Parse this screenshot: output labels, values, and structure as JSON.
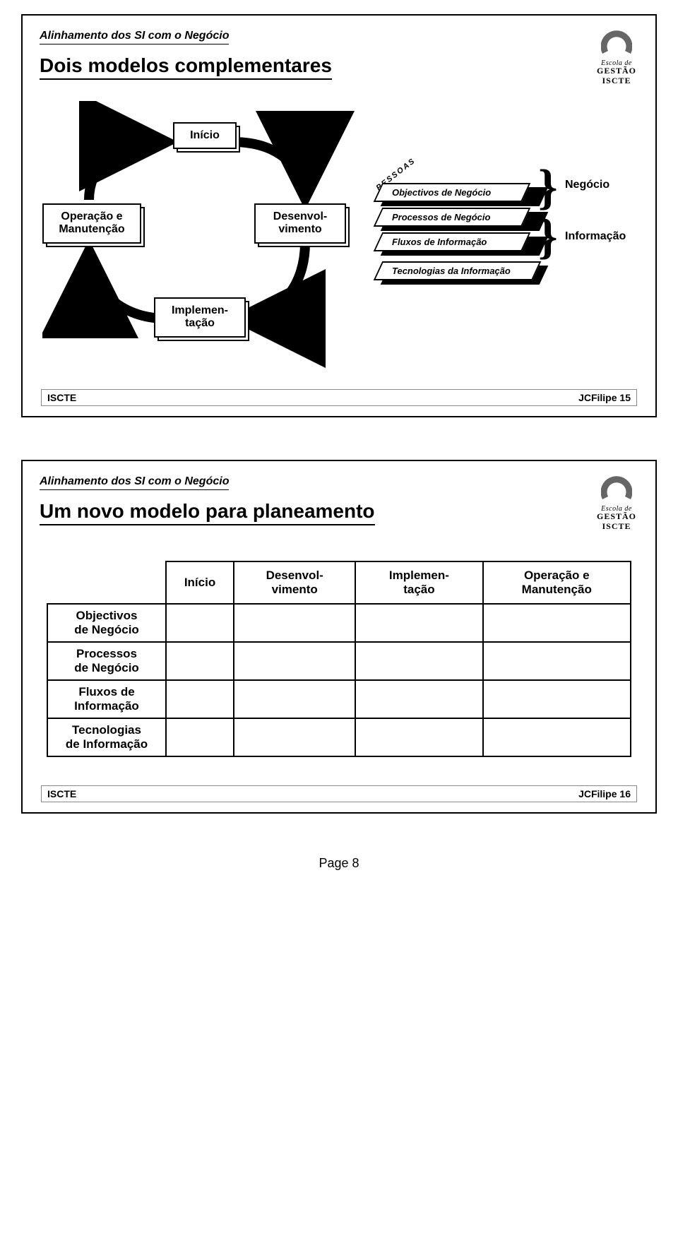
{
  "common": {
    "header": "Alinhamento dos SI com o Negócio",
    "footer_left": "ISCTE",
    "footer_right": "JCFilipe",
    "logo": {
      "l1": "Escola de",
      "l2": "GESTÃO",
      "l3": "ISCTE"
    }
  },
  "slide1": {
    "title": "Dois modelos complementares",
    "boxes": {
      "inicio": "Início",
      "operacao": "Operação e\nManutenção",
      "desenvolvimento": "Desenvol-\nvimento",
      "implementacao": "Implemen-\ntação"
    },
    "stack": {
      "pessoas": "PESSOAS",
      "l1": "Objectivos de Negócio",
      "l2": "Processos de Negócio",
      "l3": "Fluxos de Informação",
      "l4": "Tecnologias da Informação"
    },
    "braces": {
      "top": "}",
      "bottom": "}"
    },
    "side": {
      "top": "Negócio",
      "bottom": "Informação"
    },
    "page": "15"
  },
  "slide2": {
    "title": "Um novo modelo para planeamento",
    "cols": {
      "c1": "Início",
      "c2": "Desenvol-\nvimento",
      "c3": "Implemen-\ntação",
      "c4": "Operação e\nManutenção"
    },
    "rows": {
      "r1": "Objectivos\nde Negócio",
      "r2": "Processos\nde Negócio",
      "r3": "Fluxos de\nInformação",
      "r4": "Tecnologias\nde Informação"
    },
    "page": "16"
  },
  "page_footer": "Page 8"
}
